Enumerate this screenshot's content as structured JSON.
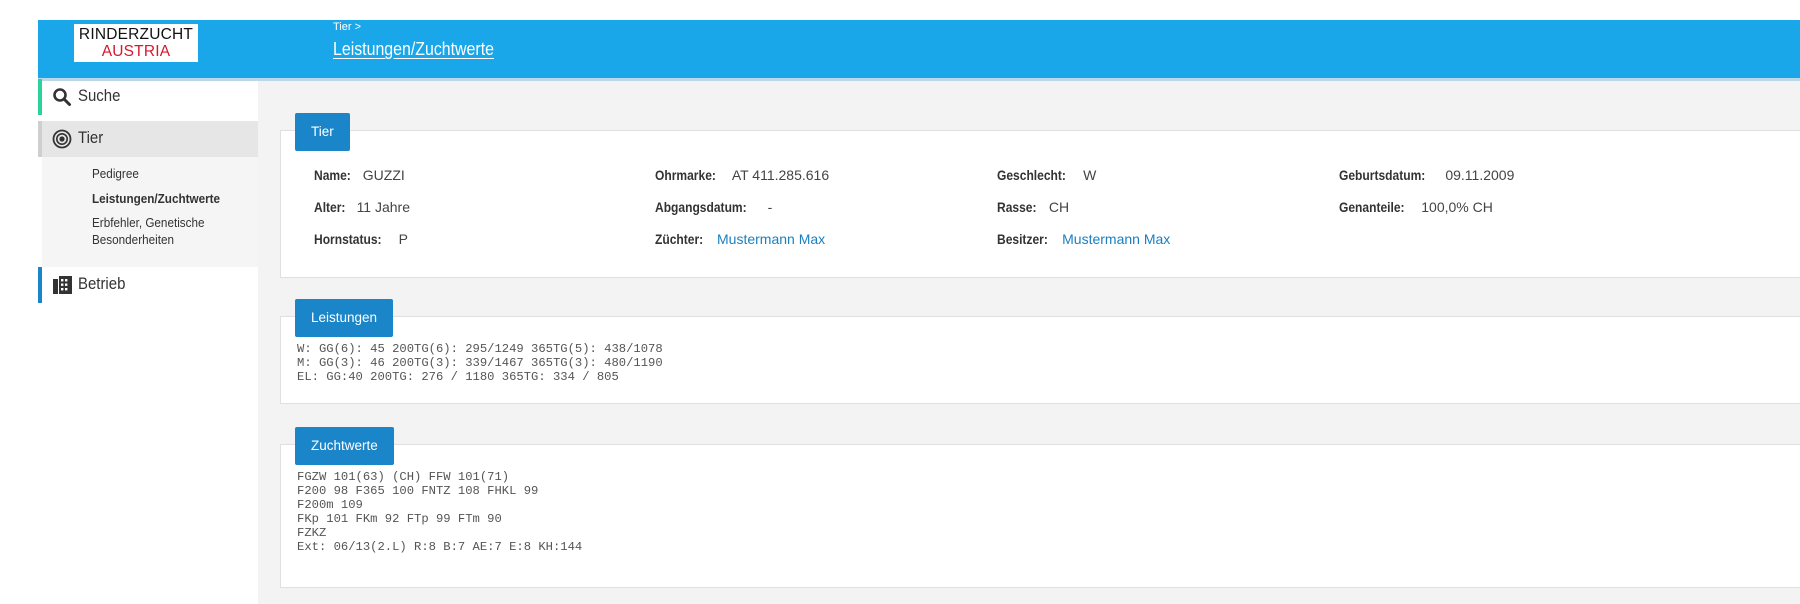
{
  "logo": {
    "line1": "RINDERZUCHT",
    "line2": "AUSTRIA"
  },
  "header": {
    "breadcrumb": "Tier >",
    "title": "Leistungen/Zuchtwerte"
  },
  "sidebar": {
    "items": [
      {
        "label": "Suche",
        "icon": "search-icon"
      },
      {
        "label": "Tier",
        "icon": "target-icon"
      },
      {
        "label": "Betrieb",
        "icon": "building-icon"
      }
    ],
    "sub_items": [
      "Pedigree",
      "Leistungen/Zuchtwerte",
      "Erbfehler, Genetische",
      "Besonderheiten"
    ]
  },
  "tier": {
    "tag": "Tier",
    "fields": [
      {
        "key": "Name:",
        "value": "GUZZI"
      },
      {
        "key": "Ohrmarke:",
        "value": "AT 411.285.616"
      },
      {
        "key": "Geschlecht:",
        "value": "W"
      },
      {
        "key": "Geburtsdatum:",
        "value": "09.11.2009"
      },
      {
        "key": "Alter:",
        "value": "11 Jahre"
      },
      {
        "key": "Abgangsdatum:",
        "value": "-"
      },
      {
        "key": "Rasse:",
        "value": "CH"
      },
      {
        "key": "Genanteile:",
        "value": "100,0% CH"
      },
      {
        "key": "Hornstatus:",
        "value": "P"
      },
      {
        "key": "Züchter:",
        "value": "Mustermann Max"
      },
      {
        "key": "Besitzer:",
        "value": "Mustermann Max"
      }
    ]
  },
  "leistungen": {
    "tag": "Leistungen",
    "lines": [
      "W: GG(6): 45 200TG(6): 295/1249 365TG(5): 438/1078",
      "M: GG(3): 46 200TG(3): 339/1467 365TG(3): 480/1190",
      "EL: GG:40 200TG: 276 / 1180 365TG: 334 / 805"
    ]
  },
  "zuchtwerte": {
    "tag": "Zuchtwerte",
    "lines": [
      "FGZW 101(63) (CH) FFW 101(71)",
      "F200 98 F365 100 FNTZ 108 FHKL 99",
      "F200m 109",
      "FKp 101 FKm 92 FTp 99 FTm 90",
      "FZKZ",
      "Ext: 06/13(2.L) R:8 B:7 AE:7 E:8 KH:144"
    ]
  },
  "colors": {
    "header": "#19a7e9",
    "tag": "#1a85c8",
    "link": "#1a7fc0",
    "suche_accent": "#2bd29a",
    "tier_accent": "#1a85c8"
  }
}
